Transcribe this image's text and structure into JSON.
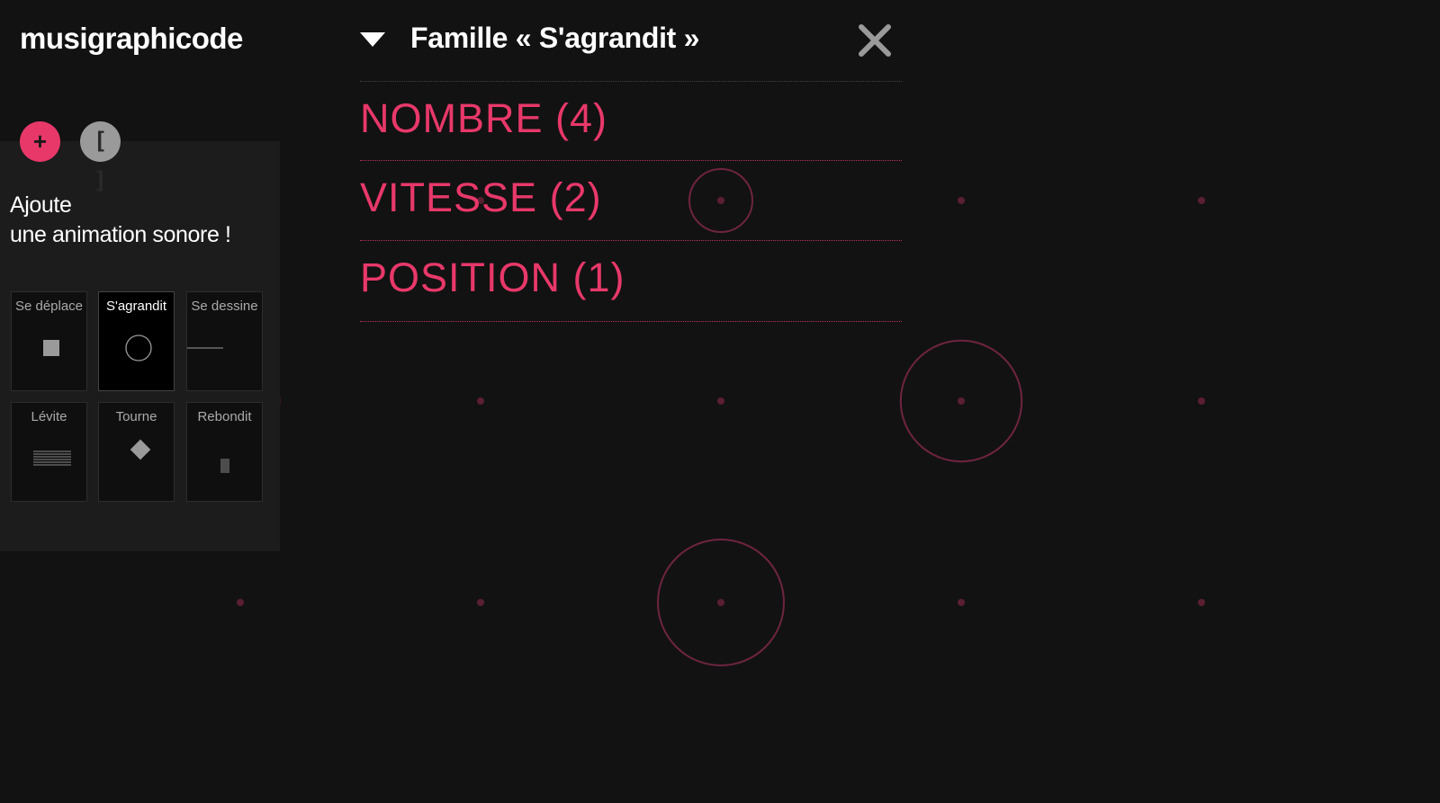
{
  "app": {
    "title": "musigraphicode"
  },
  "toolbar": {
    "add_label": "+",
    "bracket_label": "[ ]"
  },
  "panel": {
    "heading_line1": "Ajoute",
    "heading_line2": "une animation sonore !"
  },
  "families": [
    {
      "label": "Se déplace",
      "icon": "square-icon",
      "selected": false
    },
    {
      "label": "S'agrandit",
      "icon": "circle-icon",
      "selected": true
    },
    {
      "label": "Se dessine",
      "icon": "line-icon",
      "selected": false
    },
    {
      "label": "Lévite",
      "icon": "horizontal-lines-icon",
      "selected": false
    },
    {
      "label": "Tourne",
      "icon": "diamond-icon",
      "selected": false
    },
    {
      "label": "Rebondit",
      "icon": "vertical-lines-icon",
      "selected": false
    }
  ],
  "dropdown": {
    "title": "Famille « S'agrandit »",
    "items": [
      {
        "label": "NOMBRE",
        "count": "(4)"
      },
      {
        "label": "VITESSE",
        "count": "(2)"
      },
      {
        "label": "POSITION",
        "count": "(1)"
      }
    ]
  },
  "colors": {
    "background": "#121212",
    "panel": "#1c1c1c",
    "accent": "#e8386a",
    "dot": "#5a1f30",
    "ring": "#6e2440"
  },
  "canvas": {
    "grid_columns": 5,
    "grid_rows": 3,
    "ring_levels": [
      {
        "column": 2,
        "row": 0,
        "level": 0.5
      },
      {
        "column": 0,
        "row": 1,
        "level": 0.62
      },
      {
        "column": 3,
        "row": 1,
        "level": 0.96
      },
      {
        "column": 2,
        "row": 2,
        "level": 1.0
      }
    ]
  }
}
